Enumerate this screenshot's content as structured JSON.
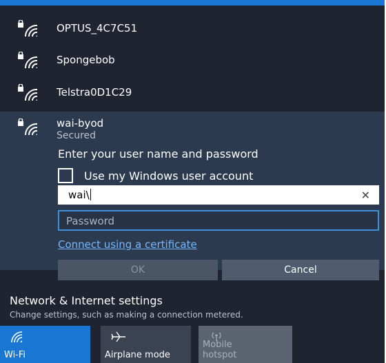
{
  "networks": [
    {
      "name": "OPTUS_4C7C51",
      "icon": "wifi-secured-icon"
    },
    {
      "name": "Spongebob",
      "icon": "wifi-secured-icon"
    },
    {
      "name": "Telstra0D1C29",
      "icon": "wifi-secured-icon"
    }
  ],
  "selected_network": {
    "name": "wai-byod",
    "status": "Secured",
    "prompt": "Enter your user name and password",
    "checkbox_label": "Use my Windows user account",
    "username_value": "wai\\",
    "password_placeholder": "Password",
    "certificate_link": "Connect using a certificate",
    "ok_label": "OK",
    "cancel_label": "Cancel"
  },
  "settings": {
    "title": "Network & Internet settings",
    "subtitle": "Change settings, such as making a connection metered."
  },
  "quick_actions": [
    {
      "label": "Wi-Fi",
      "icon": "wifi-icon",
      "state": "on"
    },
    {
      "label": "Airplane mode",
      "icon": "airplane-icon",
      "state": "off"
    },
    {
      "label_line1": "Mobile",
      "label_line2": "hotspot",
      "icon": "hotspot-icon",
      "state": "disabled"
    }
  ],
  "colors": {
    "accent": "#1976d2",
    "panel": "#1f2430",
    "selected": "#2b3a4f",
    "link": "#77b7ff"
  }
}
